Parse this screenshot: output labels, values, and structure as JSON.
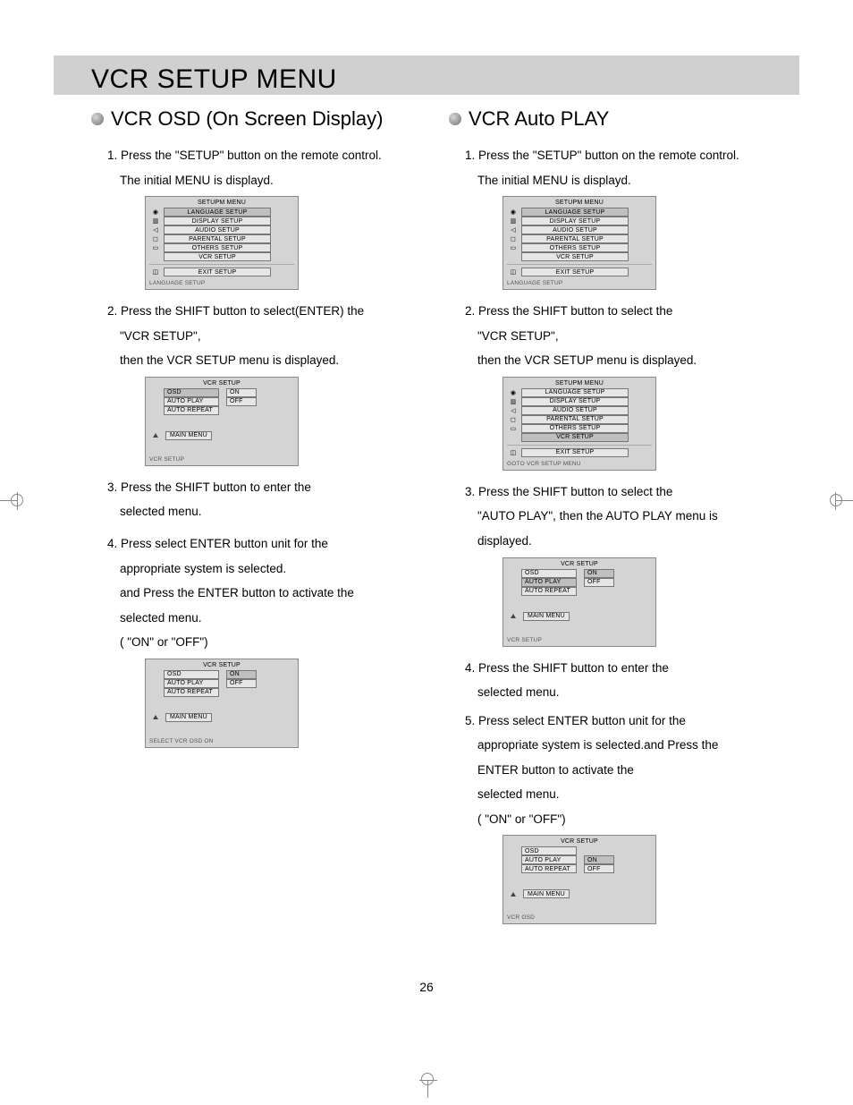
{
  "page_number": "26",
  "title": "VCR SETUP MENU",
  "left": {
    "heading": "VCR OSD (On Screen Display)",
    "step1a": "1. Press the \"SETUP\" button on the remote control.",
    "step1b": "The initial MENU is displayd.",
    "step2a": "2. Press the SHIFT      button to select(ENTER) the",
    "step2b": "\"VCR SETUP\",",
    "step2c": "then the VCR SETUP menu is displayed.",
    "step3a": "3. Press the SHIFT      button to enter the",
    "step3b": "selected menu.",
    "step4a": "4. Press select ENTER button unit for the",
    "step4b": "appropriate system is selected.",
    "step4c": "and Press the ENTER button to activate the",
    "step4d": "selected menu.",
    "step4e": "( \"ON\" or \"OFF\")"
  },
  "right": {
    "heading": "VCR Auto PLAY",
    "step1a": "1. Press the \"SETUP\" button on the remote control.",
    "step1b": "The initial MENU is displayd.",
    "step2a": "2. Press the SHIFT      button to select the",
    "step2b": "\"VCR SETUP\",",
    "step2c": "then the VCR SETUP menu is displayed.",
    "step3a": "3. Press the SHIFT      button to select the",
    "step3b": "\"AUTO PLAY\", then the AUTO PLAY menu is",
    "step3c": "displayed.",
    "step4a": "4. Press the SHIFT      button to enter the",
    "step4b": "selected menu.",
    "step5a": "5. Press select ENTER button unit for the",
    "step5b": "appropriate system is selected.and Press the",
    "step5c": "ENTER button to activate the",
    "step5d": "selected menu.",
    "step5e": "( \"ON\" or \"OFF\")"
  },
  "osd_setup": {
    "title": "SETUPM MENU",
    "items": [
      "LANGUAGE SETUP",
      "DISPLAY SETUP",
      "AUDIO SETUP",
      "PARENTAL SETUP",
      "OTHERS SETUP",
      "VCR SETUP"
    ],
    "exit": "EXIT SETUP",
    "footer_lang": "LANGUAGE SETUP",
    "footer_goto": "GOTO VCR  SETUP MENU"
  },
  "osd_vcr": {
    "title": "VCR SETUP",
    "rows": [
      "OSD",
      "AUTO PLAY",
      "AUTO REPEAT"
    ],
    "opts": [
      "ON",
      "OFF"
    ],
    "main": "MAIN MENU",
    "footer_vcr": "VCR SETUP",
    "footer_sel": "SELECT VCR OSD ON",
    "footer_osd": "VCR OSD"
  }
}
